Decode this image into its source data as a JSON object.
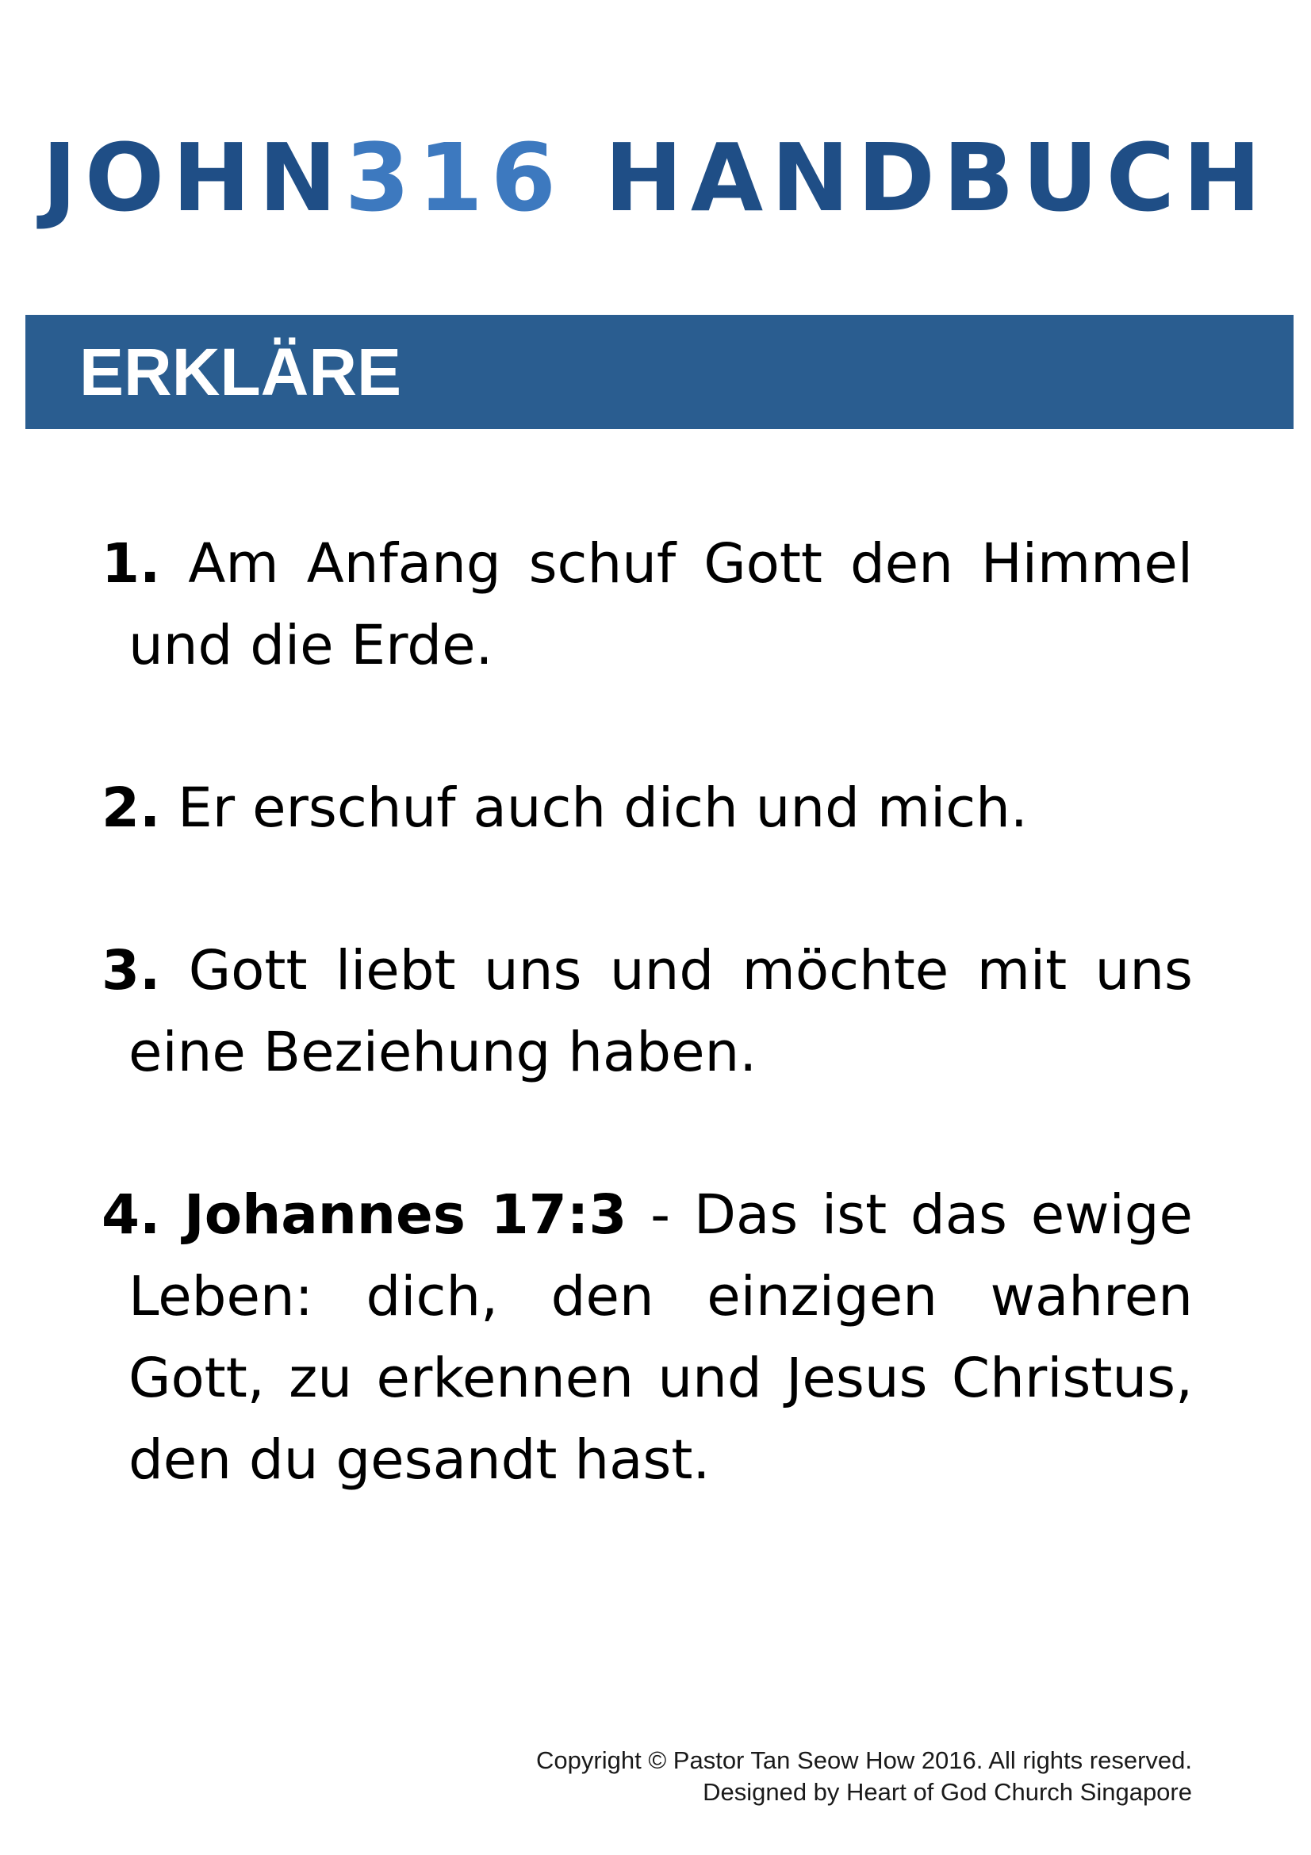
{
  "header": {
    "title_part1": "JOHN",
    "title_part2": "316",
    "title_part3": " HANDBUCH"
  },
  "banner": {
    "label": "ERKLÄRE"
  },
  "items": [
    {
      "number": "1.",
      "text": "Am Anfang schuf Gott den Himmel und die Erde."
    },
    {
      "number": "2.",
      "text": "Er erschuf auch dich und mich."
    },
    {
      "number": "3.",
      "text": "Gott liebt uns und möchte mit uns eine Beziehung haben."
    },
    {
      "number": "4.",
      "reference": "Johannes 17:3",
      "separator": " - ",
      "text": "Das ist das ewige Leben: dich, den einzigen wahren Gott, zu erkennen und Jesus Christus, den du gesandt hast."
    }
  ],
  "footer": {
    "copyright": "Copyright © Pastor Tan Seow How 2016. All rights reserved.",
    "designed_by": "Designed by Heart of God Church Singapore"
  },
  "colors": {
    "title": "#1f4e86",
    "title_accent": "#3d79bf",
    "banner": "#2a5d90",
    "banner_text": "#ffffff"
  }
}
